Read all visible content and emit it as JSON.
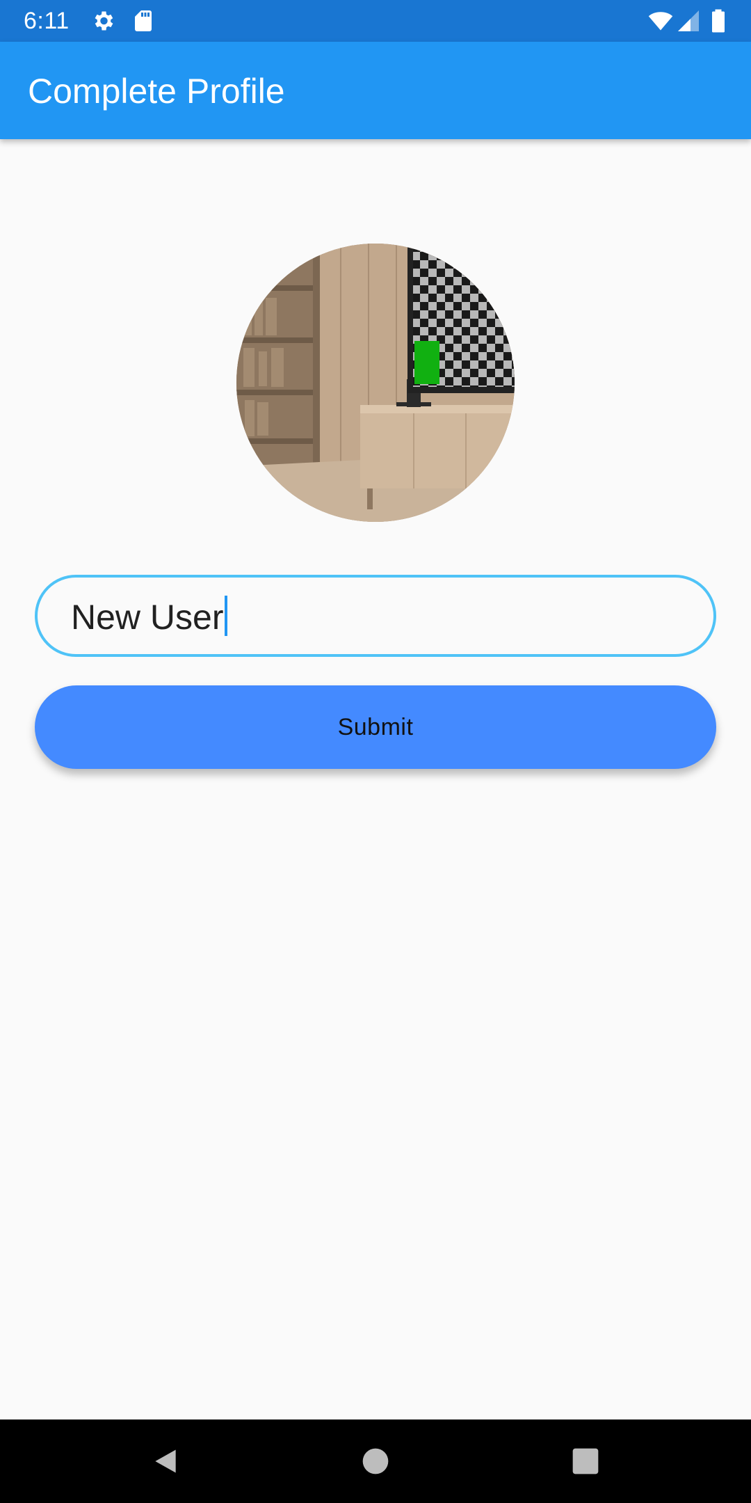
{
  "status_bar": {
    "time": "6:11",
    "icons": [
      "gear-icon",
      "sd-card-icon",
      "wifi-icon",
      "signal-icon",
      "battery-icon"
    ]
  },
  "app_bar": {
    "title": "Complete Profile"
  },
  "profile": {
    "avatar": "profile-photo-room-interior"
  },
  "form": {
    "name_value": "New User",
    "submit_label": "Submit"
  },
  "navigation": {
    "icons": [
      "back-icon",
      "home-icon",
      "recents-icon"
    ]
  },
  "colors": {
    "status_bar": "#1976d2",
    "app_bar": "#2196f3",
    "field_border": "#4fc3f7",
    "button": "#448aff",
    "background": "#fafafa"
  }
}
